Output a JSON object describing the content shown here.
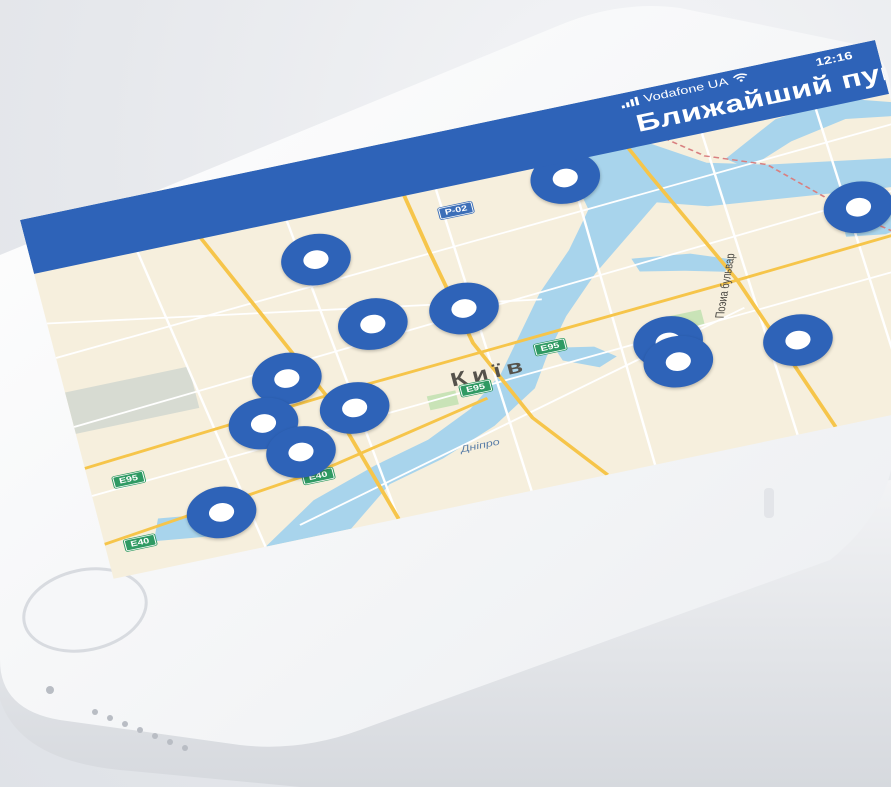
{
  "status_bar": {
    "carrier": "Vodafone UA",
    "time": "12:16"
  },
  "navbar": {
    "title": "Ближайший пункт"
  },
  "map": {
    "city_label": "Київ",
    "street_label": "Поэиа бульвар",
    "river_label": "Дніпро",
    "highway_badges": [
      "Р-02",
      "E95",
      "E95",
      "E95",
      "E40",
      "E40"
    ],
    "pin_count": 14
  },
  "colors": {
    "brand_blue": "#2e63b8",
    "map_land": "#f6efdd",
    "map_water": "#a8d4ec",
    "road": "#f6c54a"
  }
}
